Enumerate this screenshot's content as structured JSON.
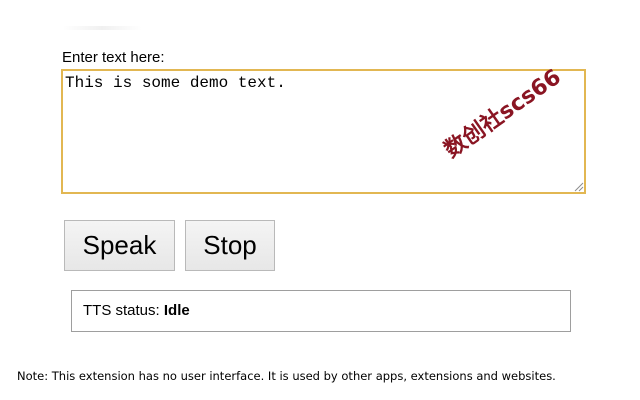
{
  "editor": {
    "label": "Enter text here:",
    "value": "This is some demo text."
  },
  "watermark": {
    "text": "数创社scs66"
  },
  "buttons": {
    "speak_label": "Speak",
    "stop_label": "Stop"
  },
  "status": {
    "prefix": "TTS status: ",
    "value": "Idle"
  },
  "footer": {
    "note": "Note: This extension has no user interface. It is used by other apps, extensions and websites."
  },
  "colors": {
    "textarea_border": "#e2b752",
    "watermark": "#8a1523"
  }
}
